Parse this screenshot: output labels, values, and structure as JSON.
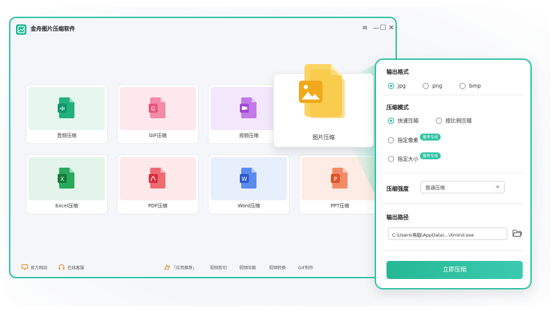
{
  "window": {
    "title": "金舟图片压缩软件",
    "controls": [
      "≡",
      "—",
      "☐",
      "✕"
    ]
  },
  "tools": [
    {
      "label": "音频压缩",
      "icon": "audio-file-icon",
      "tint": "#e6f6ef",
      "color": "#22b07d"
    },
    {
      "label": "GIF压缩",
      "icon": "gif-file-icon",
      "tint": "#fde8ee",
      "color": "#f0678e"
    },
    {
      "label": "视频压缩",
      "icon": "video-file-icon",
      "tint": "#f3e8fb",
      "color": "#b458e6"
    },
    {
      "label": "Excel压缩",
      "icon": "excel-file-icon",
      "tint": "#e3f4ea",
      "color": "#1f9a4f"
    },
    {
      "label": "PDF压缩",
      "icon": "pdf-file-icon",
      "tint": "#fde9ea",
      "color": "#e84a55"
    },
    {
      "label": "Word压缩",
      "icon": "word-file-icon",
      "tint": "#e7eefc",
      "color": "#3a6fe0"
    },
    {
      "label": "PPT压缩",
      "icon": "ppt-file-icon",
      "tint": "#fdece6",
      "color": "#ef6e47"
    }
  ],
  "highlight": {
    "label": "图片压缩",
    "icon": "image-file-icon",
    "color": "#f2b52a"
  },
  "footer": {
    "website": "官方网站",
    "service": "在线客服",
    "recommend": "「应用推荐」",
    "links": [
      "视频剪切",
      "视频压缩",
      "视频转换",
      "GIF制作"
    ]
  },
  "settings": {
    "format_title": "输出格式",
    "formats": [
      "jpg",
      "png",
      "bmp"
    ],
    "selected_format": "jpg",
    "mode_title": "压缩模式",
    "modes": [
      "快速压缩",
      "按比例压缩",
      "指定像素",
      "指定大小"
    ],
    "selected_mode": "快速压缩",
    "badge": "报考专用",
    "strength_label": "压缩强度",
    "strength_value": "普通压缩",
    "path_title": "输出路径",
    "path_value": "C:\\Users\\电脑\\AppData\\...\\Xmind.exe",
    "submit": "立即压缩"
  },
  "colors": {
    "accent": "#2fc3a4",
    "button": "#26b894"
  }
}
